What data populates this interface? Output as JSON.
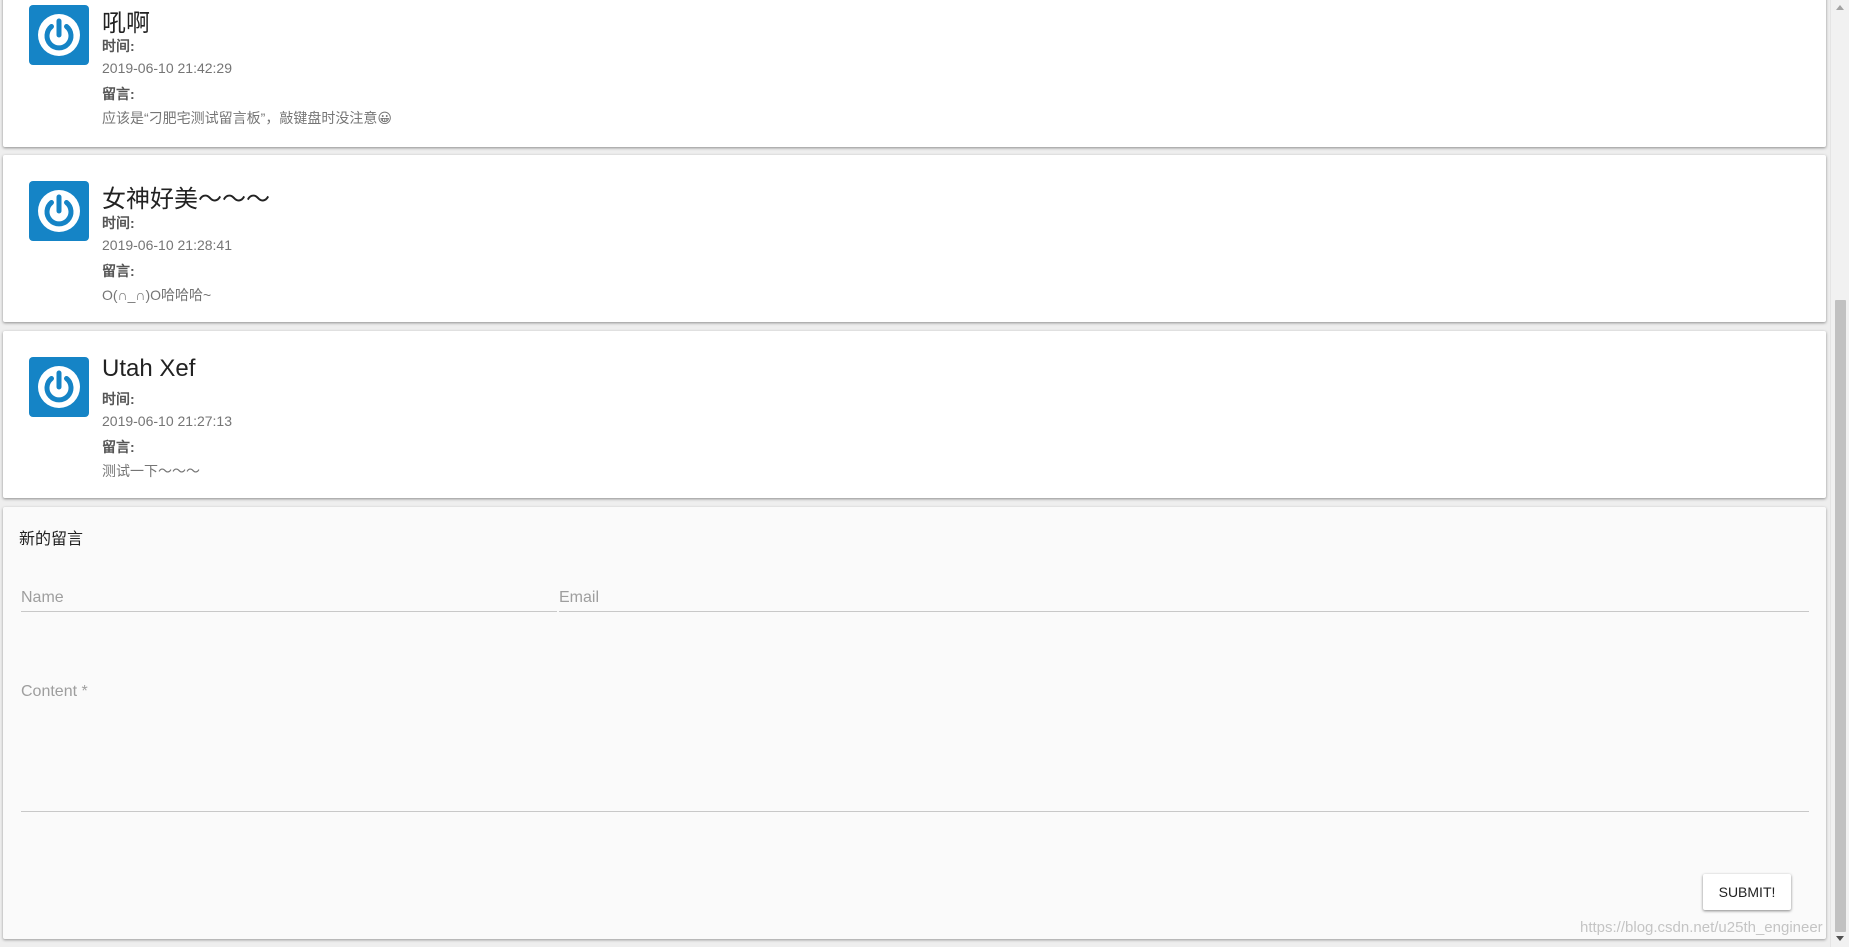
{
  "messages": [
    {
      "name": "吼啊",
      "time_label": "时间:",
      "time": "2019-06-10 21:42:29",
      "content_label": "留言:",
      "content": "应该是“刁肥宅测试留言板”，敲键盘时没注意😀",
      "avatar_icon": "power-icon"
    },
    {
      "name": "女神好美～～～",
      "time_label": "时间:",
      "time": "2019-06-10 21:28:41",
      "content_label": "留言:",
      "content": "O(∩_∩)O哈哈哈~",
      "avatar_icon": "power-icon"
    },
    {
      "name": "Utah Xef",
      "time_label": "时间:",
      "time": "2019-06-10 21:27:13",
      "content_label": "留言:",
      "content": "测试一下～～～",
      "avatar_icon": "power-icon"
    }
  ],
  "form": {
    "title": "新的留言",
    "name_placeholder": "Name",
    "email_placeholder": "Email",
    "content_placeholder": "Content *",
    "submit_label": "SUBMIT!"
  },
  "watermark": "https://blog.csdn.net/u25th_engineer",
  "colors": {
    "avatar_bg": "#1584c6",
    "background": "#eeeeee",
    "card": "#ffffff"
  }
}
